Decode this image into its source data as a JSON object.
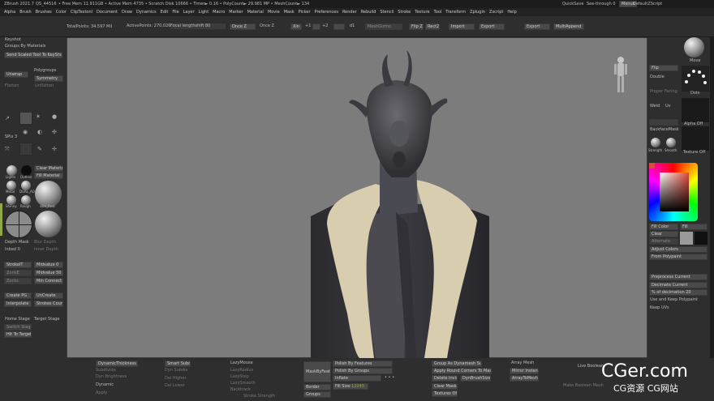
{
  "title_bar": {
    "app_title": "ZBrush 2021.7",
    "file": "QS_44516",
    "stats": "• Free Mem 11.911GB • Active Mem 4735 • Scratch Disk 10666 • Timer► 0.16 • PolyCount► 29.981 MP • MeshCount► 134",
    "quicksave": "QuickSave",
    "seethrough": "See-through 0",
    "menus": "Menus",
    "script": "DefaultZScript"
  },
  "menu_bar": [
    "Alpha",
    "Brush",
    "Brushes",
    "Color",
    "ClipTextonl",
    "Document",
    "Draw",
    "Dynamics",
    "Edit",
    "File",
    "Layer",
    "Light",
    "Macro",
    "Marker",
    "Material",
    "Movie",
    "Mask",
    "Picker",
    "Preferences",
    "Render",
    "Rebuild",
    "Stencil",
    "Stroke",
    "Texture",
    "Tool",
    "Transform",
    "Zplugin",
    "Zscript",
    "Help"
  ],
  "top_bar": {
    "total_points": "TotalPoints: 34.597 Mil",
    "active_points": "ActivePoints: 270,026",
    "focal": "Focal lengthshift 80",
    "once_z": "Once Z",
    "once_z2": "Once Z",
    "x_btn": "Xin",
    "plus1": "+1",
    "plus2": "+2",
    "plus3": "+3",
    "d_btn": "d1",
    "stackbox": "MeshGizmo",
    "flip_z": "Flip Z",
    "rect_z": "Rect2",
    "import": "Import",
    "export": "Export",
    "export2": "Export",
    "multi_append": "MultiAppend"
  },
  "left_panel": {
    "keyshot": "Keyshot",
    "groups_by_materials": "Groups By Materials",
    "send_button": "Send Scaled Tool To KeyShot",
    "unwrap": "Unwrap",
    "polygroups": "Polygroups",
    "symmetry": "Symmetry",
    "flatten": "Flatten",
    "unflatten": "Unflatten",
    "spix": "SPix 3",
    "mat_labels": [
      "Lights",
      "Outline"
    ],
    "clear_material": "Clear Material",
    "fill_material": "Fill Material",
    "mat_names": [
      "Metal",
      "DUAL_AO",
      "Shinny",
      "Rough"
    ],
    "big_mat": "skin_final",
    "depth_mask": "Depth Mask",
    "inbed": "Inbed 0",
    "blur_depth": "Blur Depth",
    "inner_depth": "Inner Depth",
    "stroke_list": [
      "StrokeIT",
      "ZorlsE",
      "Zorlsc"
    ],
    "stroke_vals": [
      "Midvalue 0",
      "Midvalue 50",
      "Min Connect 0"
    ],
    "create_pg": "Create PG",
    "uncreate": "UnCreate",
    "interpolate": "Interpolate",
    "strokes_count": "Strokes Count 12",
    "home_stage": "Home Stage",
    "target_stage": "Target Stage",
    "switch_stage": "Switch Stage",
    "hit_to_target": "Hit To Target"
  },
  "right_panel": {
    "move": "Move",
    "flip": "Flip",
    "double": "Double",
    "proper_facing": "Proper Facing",
    "dots": "Dots",
    "weld": "Weld",
    "uv": "Uv",
    "alpha_off": "Alpha Off",
    "backface_mask": "BackfaceMask",
    "strength": "Strength",
    "smooth": "Smooth",
    "texture_off": "Texture Off",
    "fill_color": "Fill Color",
    "fill_btn": "Fill",
    "clear": "Clear",
    "alternate": "Alternate",
    "adjust_colors": "Adjust Colors",
    "from_polypaint": "From Polypaint",
    "preprocess": "Preprocess Current",
    "decimate": "Decimate Current",
    "pct_decimation": "% of decimation 20",
    "use_keep": "Use and Keep Polypaint",
    "keep_uvs": "Keep UVs"
  },
  "bottom_panel": {
    "dynamic_thickness": "DynamicThickness",
    "subdivide": "Subdivide",
    "smart_subdiv": "Smart Subdiv",
    "dyn_labels": [
      "Dyn Brightness",
      "Dyn Subdiv"
    ],
    "dynamic": "Dynamic",
    "apply": "Apply",
    "del_higher": "Del Higher",
    "del_lower": "Del Lower",
    "lazy_mouse": "LazyMouse",
    "lazy_labels": [
      "LazyRadius",
      "LazyStep",
      "LazySmooth",
      "Backtrack",
      "Stroke Strength"
    ],
    "mask_by_feature": "MaskByFeature",
    "border": "Border",
    "groups": "Groups",
    "polish_features": "Polish By Features",
    "polish_groups": "Polish By Groups",
    "inflate": "Inflate",
    "fill_size": "Fill Size",
    "fill_size_val": "12245",
    "dots_row": "• • •",
    "group_as_dynamesh": "Group As Dynamesh Sub",
    "apply_round": "Apply Round Corners To Mask",
    "delete_invis": "Delete Invis",
    "dyn_brush_size": "DynBrushSize",
    "clear_masks": "Clear Masks",
    "textures_off": "Textures Off",
    "array_mesh": "Array Mesh",
    "mirror_instance": "Mirror Instance",
    "array_to_mesh": "ArrayToMesh",
    "live_boolean": "Live Boolean",
    "make_boolean": "Make Boolean Mesh"
  },
  "watermark": {
    "main": "CGer.com",
    "sub": "CG资源 CG网站"
  },
  "colors": {
    "panel": "#2e2e2e",
    "canvas": "#7c7c7c",
    "accent_red": "#e04a3a",
    "fur": "#d9cdb0"
  }
}
